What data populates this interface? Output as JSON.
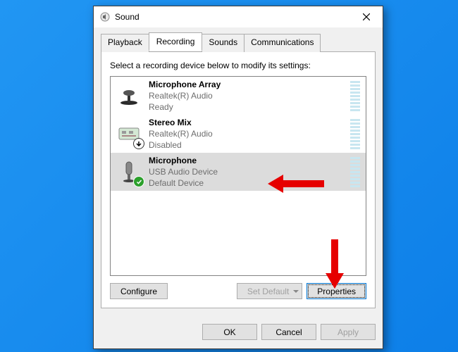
{
  "title": "Sound",
  "tabs": [
    {
      "label": "Playback"
    },
    {
      "label": "Recording"
    },
    {
      "label": "Sounds"
    },
    {
      "label": "Communications"
    }
  ],
  "active_tab": 1,
  "instruction": "Select a recording device below to modify its settings:",
  "devices": [
    {
      "name": "Microphone Array",
      "driver": "Realtek(R) Audio",
      "status": "Ready"
    },
    {
      "name": "Stereo Mix",
      "driver": "Realtek(R) Audio",
      "status": "Disabled"
    },
    {
      "name": "Microphone",
      "driver": "USB Audio Device",
      "status": "Default Device"
    }
  ],
  "panel_buttons": {
    "configure": "Configure",
    "set_default": "Set Default",
    "properties": "Properties"
  },
  "footer": {
    "ok": "OK",
    "cancel": "Cancel",
    "apply": "Apply"
  }
}
